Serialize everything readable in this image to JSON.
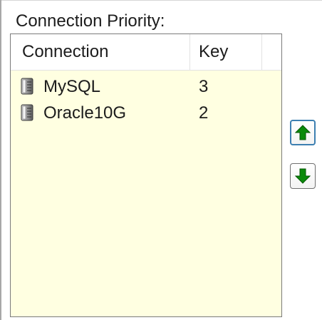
{
  "group": {
    "label": "Connection Priority:"
  },
  "list": {
    "columns": {
      "connection": "Connection",
      "key": "Key"
    },
    "rows": [
      {
        "name": "MySQL",
        "key": "3",
        "icon": "database-server-icon"
      },
      {
        "name": "Oracle10G",
        "key": "2",
        "icon": "database-server-icon"
      }
    ]
  },
  "buttons": {
    "move_up": {
      "icon": "arrow-up-icon",
      "color": "#008000"
    },
    "move_down": {
      "icon": "arrow-down-icon",
      "color": "#008000"
    }
  },
  "colors": {
    "list_background": "#ffffe1",
    "focus_border": "#3c7fb1"
  }
}
